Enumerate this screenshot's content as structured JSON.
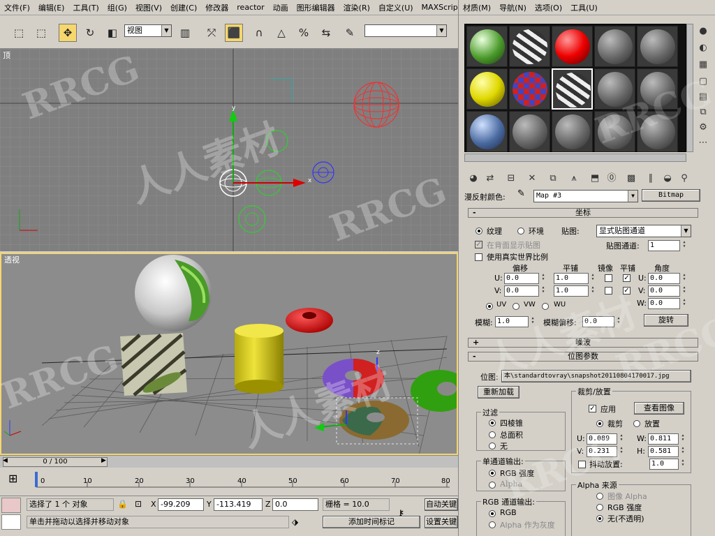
{
  "main_menu": [
    "文件(F)",
    "编辑(E)",
    "工具(T)",
    "组(G)",
    "视图(V)",
    "创建(C)",
    "修改器",
    "reactor",
    "动画",
    "图形编辑器",
    "渲染(R)",
    "自定义(U)",
    "MAXScrip"
  ],
  "mat_menu": [
    "材质(M)",
    "导航(N)",
    "选项(O)",
    "工具(U)"
  ],
  "toolbar": {
    "view_combo": "视图",
    "icons": [
      "select-region-icon",
      "select-window-icon",
      "move-icon",
      "rotate-icon",
      "scale-icon",
      "link-icon",
      "snap-icon",
      "angle-snap-icon",
      "percent-snap-icon",
      "spinner-snap-icon",
      "mirror-icon"
    ]
  },
  "viewports": {
    "top_label": "顶",
    "persp_label": "透视",
    "axis_x": "x",
    "axis_y": "y",
    "axis_z": "z"
  },
  "timeline": {
    "frame_counter": "0 / 100",
    "ticks": [
      "0",
      "10",
      "20",
      "30",
      "40",
      "50",
      "60",
      "70",
      "80"
    ]
  },
  "status": {
    "selection_text": "选择了 1 个 对象",
    "hint_text": "单击并拖动以选择并移动对象",
    "x_label": "X",
    "x_value": "-99.209",
    "y_label": "Y",
    "y_value": "-113.419",
    "z_label": "Z",
    "z_value": "0.0",
    "grid_text": "栅格 = 10.0",
    "add_time_tag": "添加时间标记",
    "auto_key": "自动关键",
    "set_key": "设置关键"
  },
  "material": {
    "map_label": "漫反射颜色:",
    "map_name": "Map #3",
    "map_type": "Bitmap",
    "coords_rollout": "坐标",
    "texture_label": "纹理",
    "env_label": "环境",
    "mapping_label": "贴图:",
    "mapping_value": "显式贴图通道",
    "show_back_label": "在背面显示贴图",
    "channel_label": "贴图通道:",
    "channel_value": "1",
    "real_world_label": "使用真实世界比例",
    "offset_header": "偏移",
    "tiling_header": "平铺",
    "mirror_header": "镜像",
    "tile_header": "平铺",
    "angle_header": "角度",
    "u_label": "U:",
    "v_label": "V:",
    "w_label": "W:",
    "u_offset": "0.0",
    "v_offset": "0.0",
    "u_tiling": "1.0",
    "v_tiling": "1.0",
    "u_angle": "0.0",
    "v_angle": "0.0",
    "w_angle": "0.0",
    "uv_label": "UV",
    "vw_label": "VW",
    "wu_label": "WU",
    "blur_label": "模糊:",
    "blur_value": "1.0",
    "blur_offset_label": "模糊偏移:",
    "blur_offset_value": "0.0",
    "rotate_button": "旋转",
    "noise_rollout": "噪波",
    "bitmap_rollout": "位图参数",
    "bitmap_label": "位图:",
    "bitmap_path": "本\\standardtovray\\snapshot20110804170017.jpg",
    "reload_button": "重新加载",
    "filter_group": "过滤",
    "filter_pyramidal": "四棱锥",
    "filter_sat": "总面积",
    "filter_none": "无",
    "mono_group": "单通道输出:",
    "mono_rgb": "RGB 强度",
    "mono_alpha": "Alpha",
    "rgb_group": "RGB 通道输出:",
    "rgb_rgb": "RGB",
    "rgb_alpha": "Alpha 作为灰度",
    "crop_group": "裁剪/放置",
    "apply_label": "应用",
    "view_image_button": "查看图像",
    "crop_label": "裁剪",
    "place_label": "放置",
    "crop_u_label": "U:",
    "crop_u": "0.089",
    "crop_w_label": "W:",
    "crop_w": "0.811",
    "crop_v_label": "V:",
    "crop_v": "0.231",
    "crop_h_label": "H:",
    "crop_h": "0.581",
    "jitter_label": "抖动放置:",
    "jitter_value": "1.0",
    "alpha_group": "Alpha 来源",
    "alpha_image": "图像 Alpha",
    "alpha_rgb": "RGB 强度",
    "alpha_none": "无(不透明)"
  },
  "watermark": [
    "RRCG",
    "人人素材"
  ],
  "colors": {
    "viewport_top": "#7f7f7f",
    "viewport_persp": "#8c8c8c",
    "selection_yellow": "#f5d76e"
  }
}
